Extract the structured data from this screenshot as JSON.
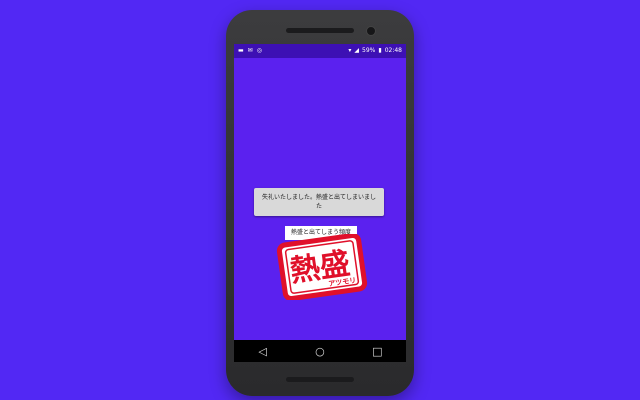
{
  "statusbar": {
    "left_icons": [
      "notification-icon",
      "mail-icon",
      "sync-icon"
    ],
    "battery_percent": "59%",
    "time": "02:48"
  },
  "main": {
    "message_button_label": "失礼いたしました。熱盛と出てしまいました",
    "frequency_label": "熱盛と出てしまう頻度",
    "stamp": {
      "main_text": "熱盛",
      "sub_text": "アツモリ",
      "color": "#e0102a"
    }
  },
  "navbar": {
    "back": "◁",
    "home": "○",
    "recents": "□"
  },
  "colors": {
    "background": "#5228f4",
    "screen": "#5b21ef",
    "statusbar": "#3d10b4"
  }
}
